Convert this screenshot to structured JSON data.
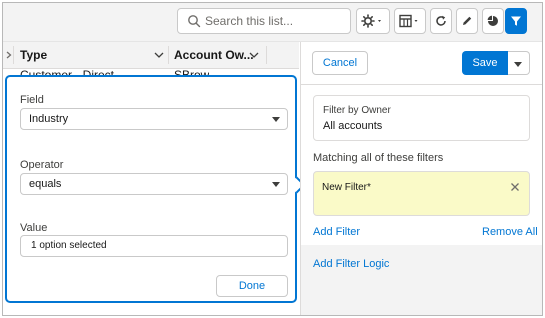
{
  "toolbar": {
    "search_placeholder": "Search this list...",
    "buttons": [
      "gear-icon",
      "table-icon",
      "refresh-icon",
      "pencil-icon",
      "chart-icon",
      "filter-icon"
    ]
  },
  "table": {
    "columns": [
      "Type",
      "Account Ow..."
    ],
    "row_peek": [
      "Customer - Direct",
      "SBrow"
    ]
  },
  "editor": {
    "field_label": "Field",
    "field_value": "Industry",
    "operator_label": "Operator",
    "operator_value": "equals",
    "value_label": "Value",
    "value_value": "1 option selected",
    "done_label": "Done"
  },
  "panel": {
    "cancel_label": "Cancel",
    "save_label": "Save",
    "owner_title": "Filter by Owner",
    "owner_value": "All accounts",
    "matching_text": "Matching all of these filters",
    "new_filter_label": "New Filter*",
    "add_filter_label": "Add Filter",
    "remove_all_label": "Remove All",
    "add_logic_label": "Add Filter Logic"
  },
  "colors": {
    "brand": "#0176d3",
    "filter_highlight": "#fafac8"
  }
}
